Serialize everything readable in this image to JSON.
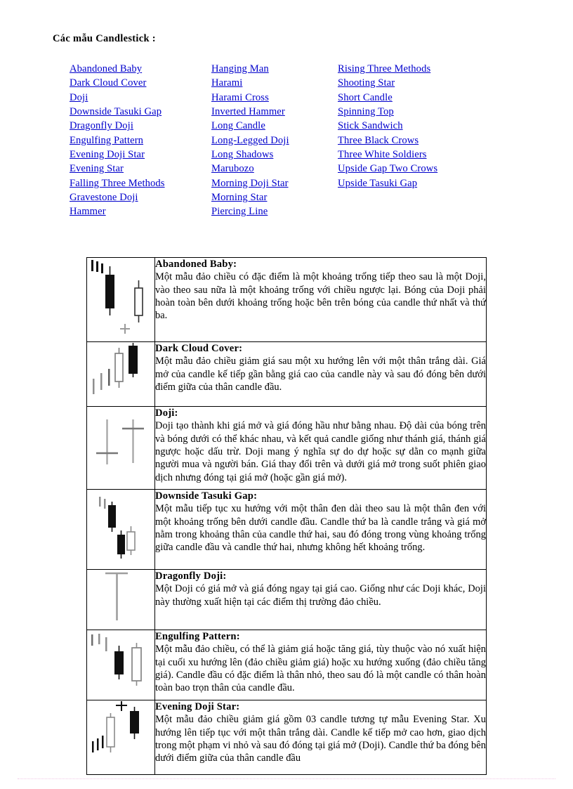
{
  "document": {
    "title": "Các mẫu  Candlestick :"
  },
  "index": {
    "columns": [
      {
        "name": "index-column-1",
        "links": [
          "Abandoned  Baby",
          "Dark Cloud Cover",
          "Doji",
          "Downside  Tasuki Gap",
          "Dragonfly  Doji",
          "Engulfing   Pattern",
          "Evening  Doji Star",
          "Evening  Star",
          "Falling  Three  Methods",
          "Gravestone  Doji",
          "Hammer"
        ]
      },
      {
        "name": "index-column-2",
        "links": [
          "Hanging  Man",
          "Harami",
          "Harami  Cross",
          "Inverted  Hammer",
          "Long  Candle",
          "Long-Legged  Doji",
          "Long  Shadows",
          "Marubozo",
          "Morning  Doji Star",
          "Morning  Star",
          "Piercing  Line"
        ]
      },
      {
        "name": "index-column-3",
        "links": [
          "Rising  Three  Methods",
          "Shooting  Star",
          "Short Candle",
          "Spinning  Top",
          "Stick Sandwich",
          "Three  Black  Crows",
          "Three  White  Soldiers",
          "Upside Gap Two Crows",
          "Upside Tasuki  Gap"
        ]
      }
    ]
  },
  "patterns": [
    {
      "id": "abandoned-baby",
      "name": "Abandoned  Baby:",
      "description": "Một mẫu đảo chiều  có đặc điểm  là một khoảng trống tiếp  theo sau là một Doji, vào theo  sau nữa là một khoảng  trống với  chiều  ngược lại. Bóng của Doji phải hoàn toàn bên dưới khoảng trống hoặc bên trên bóng của candle  thứ nhất và thứ ba.",
      "figure": "abandoned-baby-chart"
    },
    {
      "id": "dark-cloud-cover",
      "name": "Dark Cloud Cover:",
      "description": "Một mẫu đảo chiều  giảm  giá sau một xu hướng lên với  một thân trắng dài. Giá mở của candle kế tiếp gần bằng giá cao của candle này và sau đó đóng bên dưới điểm  giữa của thân candle đầu.",
      "figure": "dark-cloud-cover-chart"
    },
    {
      "id": "doji",
      "name": "Doji:",
      "description": "Doji tạo thành  khi giá mở và giá đóng hầu như bằng nhau. Độ dài của bóng trên và bóng dưới có thể khác nhau, và kết quả candle  giống như thánh  giá, thánh  giá ngược hoặc dấu trừ. Doji mang ý nghĩa  sự do dự hoặc sự dằn co mạnh  giữa người  mua và người  bán. Giá thay  đổi trên và dưới giá mở trong suốt phiên giao  dịch nhưng  đóng tại giá mở (hoặc gần giá mở).",
      "figure": "doji-chart"
    },
    {
      "id": "downside-tasuki-gap",
      "name": "Downside  Tasuki Gap:",
      "description": "Một mẫu tiếp tục xu hướng với một thân đen dài theo sau là một thân đen với một khoảng trống bên dưới candle đầu. Candle  thứ ba là candle  trắng và giá mở nằm trong khoảng thân của candle  thứ hai, sau đó đóng trong vùng  khoảng trống giữa candle  đầu và candle  thứ hai, nhưng  không hết khoảng trống.",
      "figure": "downside-tasuki-gap-chart"
    },
    {
      "id": "dragonfly-doji",
      "name": "Dragonfly Doji:",
      "description": "Một Doji có giá mở và giá đóng ngay tại giá cao. Giống như các Doji khác, Doji này thường xuất hiện tại các điểm thị trường đảo chiều.",
      "figure": "dragonfly-doji-chart"
    },
    {
      "id": "engulfing-pattern",
      "name": "Engulfing  Pattern:",
      "description": "Một mẫu đảo chiều, có thể là giảm  giá hoặc tăng giá, tùy thuộc vào nó xuất hiện tại cuối xu hướng lên (đảo chiều giảm  giá) hoặc xu hướng xuống (đảo chiều tăng giá). Candle  đầu có đặc điểm  là thân nhỏ, theo sau đó là một candle có thân hoàn toàn bao trọn thân của candle  đầu.",
      "figure": "engulfing-pattern-chart"
    },
    {
      "id": "evening-doji-star",
      "name": "Evening Doji Star:",
      "description": "Một mẫu đảo chiều giảm  giá gồm  03 candle tương tự mẫu  Evening Star. Xu hướng lên tiếp tục với một thân trắng dài. Candle kế tiếp mở cao hơn, giao dịch trong một phạm vi nhỏ và sau đó đóng tại giá mở (Doji).  Candle thứ ba đóng bên dưới điểm  giữa của thân candle  đầu",
      "figure": "evening-doji-star-chart"
    }
  ],
  "colors": {
    "link": "#0000cc",
    "text": "#000000",
    "border": "#000000",
    "candle_black": "#101010",
    "candle_white_fill": "#ffffff",
    "candle_gray": "#a8a8a8",
    "page_break_rule": "#f0c8e6"
  }
}
